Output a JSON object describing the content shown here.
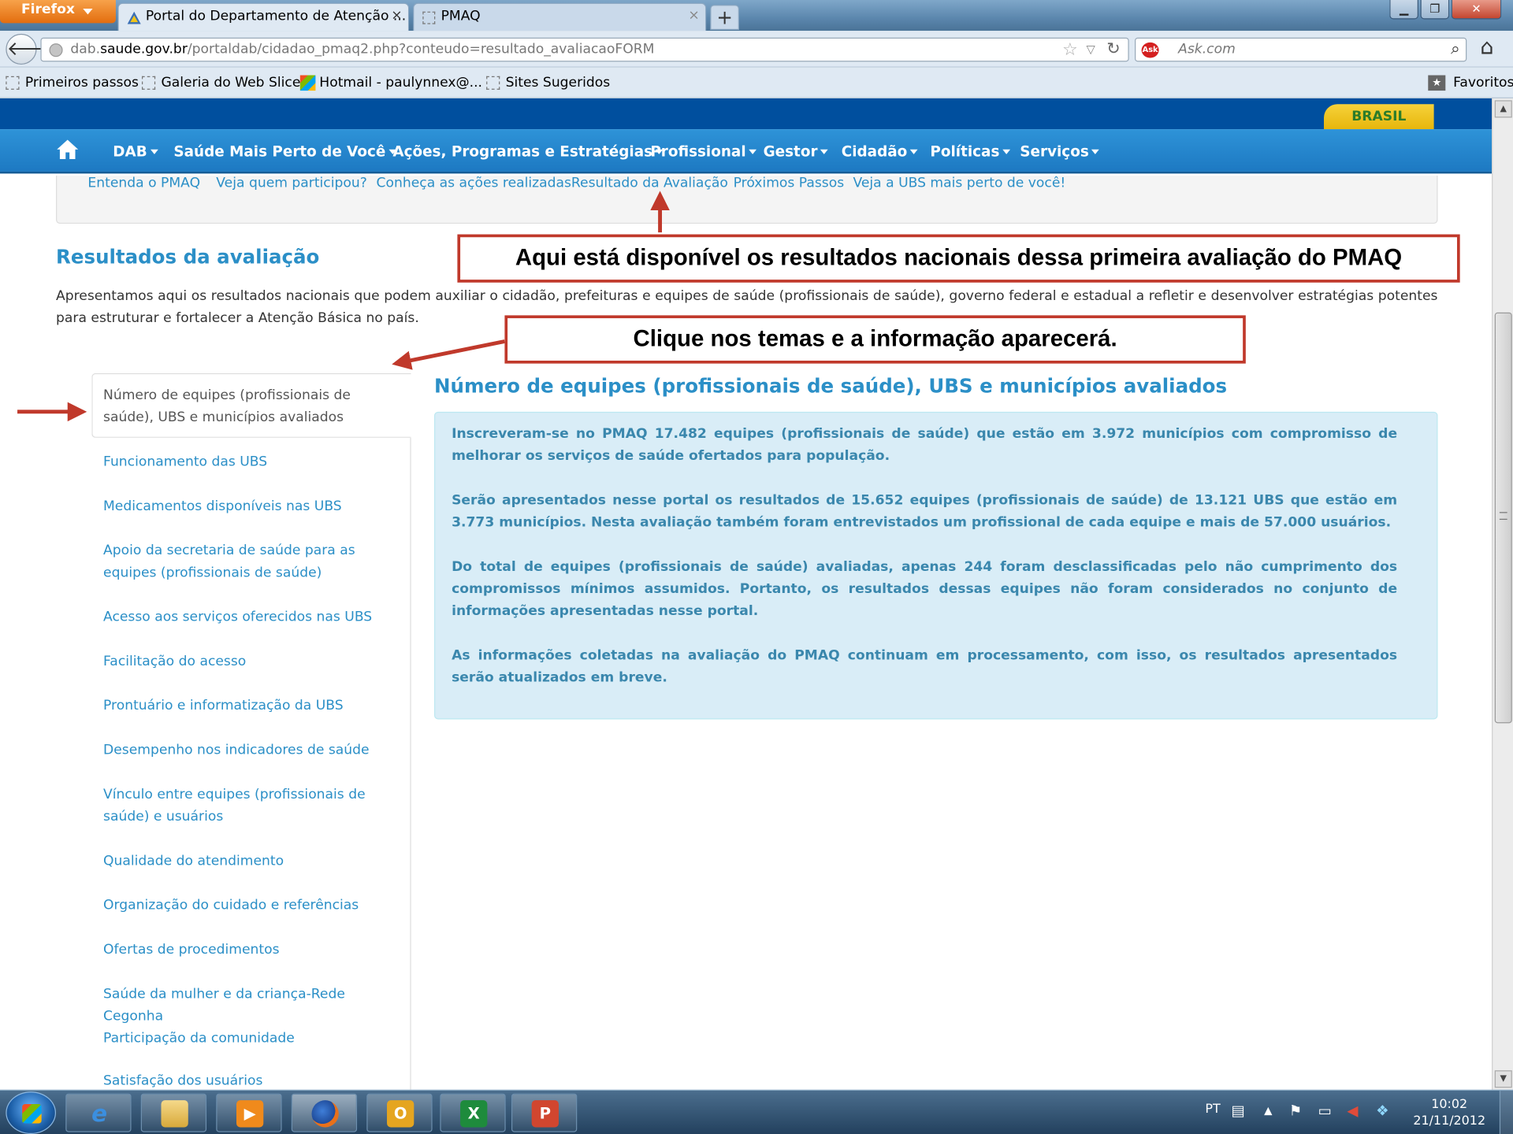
{
  "browser": {
    "app_menu": "Firefox",
    "tabs": [
      {
        "title": "Portal do Departamento de Atenção ...",
        "close": "×"
      },
      {
        "title": "PMAQ",
        "close": "×"
      }
    ],
    "new_tab": "+",
    "url_prefix": "dab.",
    "url_domain": "saude.gov.br",
    "url_path": "/portaldab/cidadao_pmaq2.php?conteudo=resultado_avaliacaoFORM",
    "search_engine": "Ask",
    "search_placeholder": "Ask.com",
    "bookmarks": [
      {
        "label": "Primeiros passos"
      },
      {
        "label": "Galeria do Web Slice"
      },
      {
        "label": "Hotmail - paulynnex@..."
      },
      {
        "label": "Sites Sugeridos"
      }
    ],
    "favorites": "Favoritos"
  },
  "site": {
    "brand": "BRASIL",
    "nav": [
      {
        "label": "DAB"
      },
      {
        "label": "Saúde Mais Perto de Você"
      },
      {
        "label": "Ações, Programas e Estratégias"
      },
      {
        "label": "Profissional"
      },
      {
        "label": "Gestor"
      },
      {
        "label": "Cidadão"
      },
      {
        "label": "Políticas"
      },
      {
        "label": "Serviços"
      }
    ],
    "subnav": [
      {
        "label": "Entenda o PMAQ"
      },
      {
        "label": "Veja quem participou?"
      },
      {
        "label": "Conheça as ações realizadas"
      },
      {
        "label": "Resultado da Avaliação"
      },
      {
        "label": "Próximos Passos"
      },
      {
        "label": "Veja a UBS mais perto de você!"
      }
    ]
  },
  "main": {
    "title": "Resultados da avaliação",
    "intro": "Apresentamos aqui os resultados nacionais que podem auxiliar o cidadão, prefeituras e equipes de saúde (profissionais de saúde), governo federal e estadual a refletir e desenvolver estratégias potentes para estruturar e fortalecer a Atenção Básica no país.",
    "side_active": "Número de equipes (profissionais de saúde), UBS e municípios avaliados",
    "side_items": [
      {
        "label": "Funcionamento das UBS"
      },
      {
        "label": "Medicamentos disponíveis nas UBS"
      },
      {
        "label": "Apoio da secretaria de saúde para as equipes (profissionais de saúde)"
      },
      {
        "label": "Acesso aos serviços oferecidos nas UBS"
      },
      {
        "label": "Facilitação do acesso"
      },
      {
        "label": "Prontuário e informatização da UBS"
      },
      {
        "label": "Desempenho nos indicadores de saúde"
      },
      {
        "label": "Vínculo entre equipes (profissionais de saúde) e usuários"
      },
      {
        "label": "Qualidade do atendimento"
      },
      {
        "label": "Organização do cuidado e referências"
      },
      {
        "label": "Ofertas de procedimentos"
      },
      {
        "label": "Saúde da mulher e da criança-Rede Cegonha"
      },
      {
        "label": "Participação da comunidade"
      },
      {
        "label": "Satisfação dos usuários"
      }
    ],
    "content_title": "Número de equipes (profissionais de saúde), UBS e municípios avaliados",
    "paragraphs": [
      "Inscreveram-se no PMAQ 17.482 equipes (profissionais de saúde) que estão em 3.972 municípios com compromisso de melhorar os serviços de saúde ofertados para população.",
      "Serão apresentados nesse portal os resultados de 15.652 equipes (profissionais de saúde) de 13.121 UBS que estão em 3.773 municípios. Nesta avaliação também foram entrevistados um profissional de cada equipe e mais de 57.000 usuários.",
      "Do total de equipes (profissionais de saúde) avaliadas, apenas 244 foram desclassificadas pelo não cumprimento dos compromissos mínimos assumidos. Portanto, os resultados dessas equipes não foram considerados no conjunto de informações apresentadas nesse portal.",
      "As informações coletadas na avaliação do PMAQ continuam em processamento, com isso, os resultados apresentados serão atualizados em breve."
    ]
  },
  "annotations": {
    "callout_1": "Aqui está disponível os resultados nacionais dessa primeira avaliação do PMAQ",
    "callout_2": "Clique nos temas e a informação aparecerá.",
    "arrow_color": "#c0392b"
  },
  "taskbar": {
    "language": "PT",
    "time": "10:02",
    "date": "21/11/2012"
  },
  "colors": {
    "gov_bar": "#004f9e",
    "nav": "#1d79c2",
    "link": "#2b8fc7",
    "info_bg": "#d9edf7",
    "info_text": "#3a87ad"
  }
}
